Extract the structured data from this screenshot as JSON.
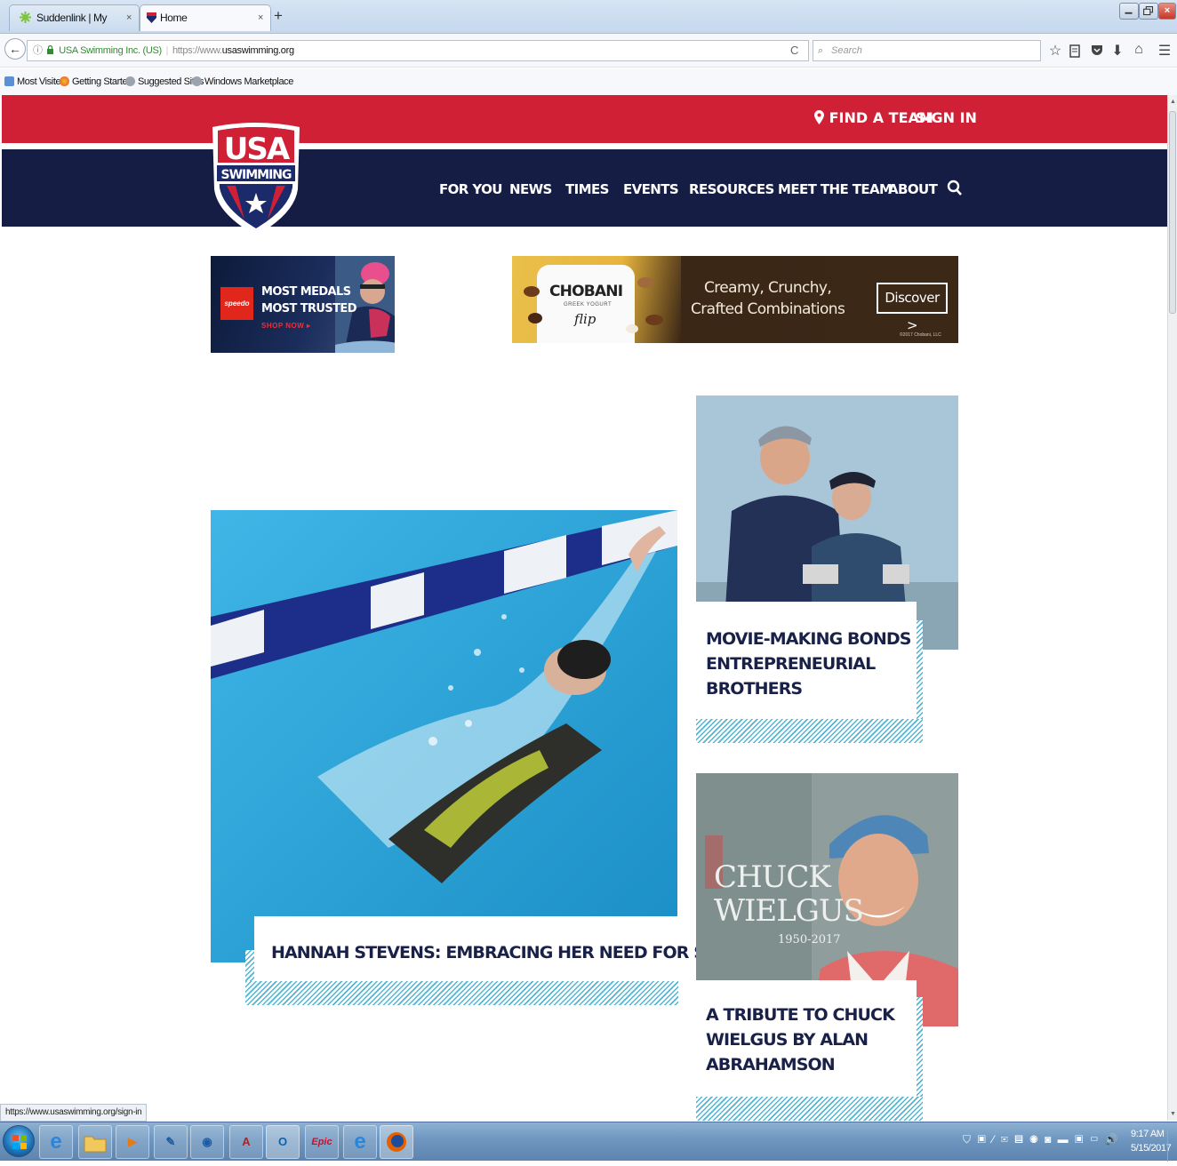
{
  "browser": {
    "tabs": [
      {
        "label": "Suddenlink | My Account -...",
        "close": "×"
      },
      {
        "label": "Home",
        "close": "×"
      }
    ],
    "new_tab": "+",
    "window_close": "×",
    "back": "←",
    "identity": "USA Swimming Inc. (US)",
    "url_protocol": "https://www.",
    "url_domain": "usaswimming.org",
    "reload": "C",
    "search_placeholder": "Search",
    "bookmarks": [
      "Most Visited",
      "Getting Started",
      "Suggested Sites",
      "Windows Marketplace"
    ],
    "status_url": "https://www.usaswimming.org/sign-in"
  },
  "header": {
    "find_team": "FIND A TEAM",
    "sign_in": "SIGN IN",
    "nav": [
      "FOR YOU",
      "NEWS",
      "TIMES",
      "EVENTS",
      "RESOURCES",
      "MEET THE TEAM",
      "ABOUT"
    ]
  },
  "ads": {
    "speedo": {
      "brand": "speedo",
      "line1": "MOST MEDALS",
      "line2": "MOST TRUSTED",
      "cta": "SHOP NOW ▸"
    },
    "chobani": {
      "brand": "CHOBANI",
      "sub": "GREEK YOGURT",
      "product": "flip",
      "line1": "Creamy, Crunchy,",
      "line2": "Crafted Combinations",
      "cta": "Discover >",
      "copyright": "©2017 Chobani, LLC"
    }
  },
  "stories": {
    "feature": {
      "title": "HANNAH STEVENS: EMBRACING HER NEED FOR SPEED"
    },
    "side1": {
      "title_lines": [
        "MOVIE-MAKING BONDS",
        "ENTREPRENEURIAL",
        "BROTHERS"
      ]
    },
    "side2": {
      "title_lines": [
        "A TRIBUTE TO CHUCK",
        "WIELGUS BY ALAN",
        "ABRAHAMSON"
      ],
      "image_name": [
        "CHUCK",
        "WIELGUS"
      ],
      "image_dates": "1950-2017"
    }
  },
  "taskbar": {
    "time": "9:17 AM",
    "date": "5/15/2017",
    "apps": [
      "ie",
      "explorer",
      "media",
      "notes",
      "app5",
      "access",
      "outlook",
      "epic",
      "ie2",
      "firefox"
    ]
  },
  "colors": {
    "red": "#cf2035",
    "navy": "#161d45",
    "stripe": "#51b6d6",
    "headline": "#1a2148"
  }
}
